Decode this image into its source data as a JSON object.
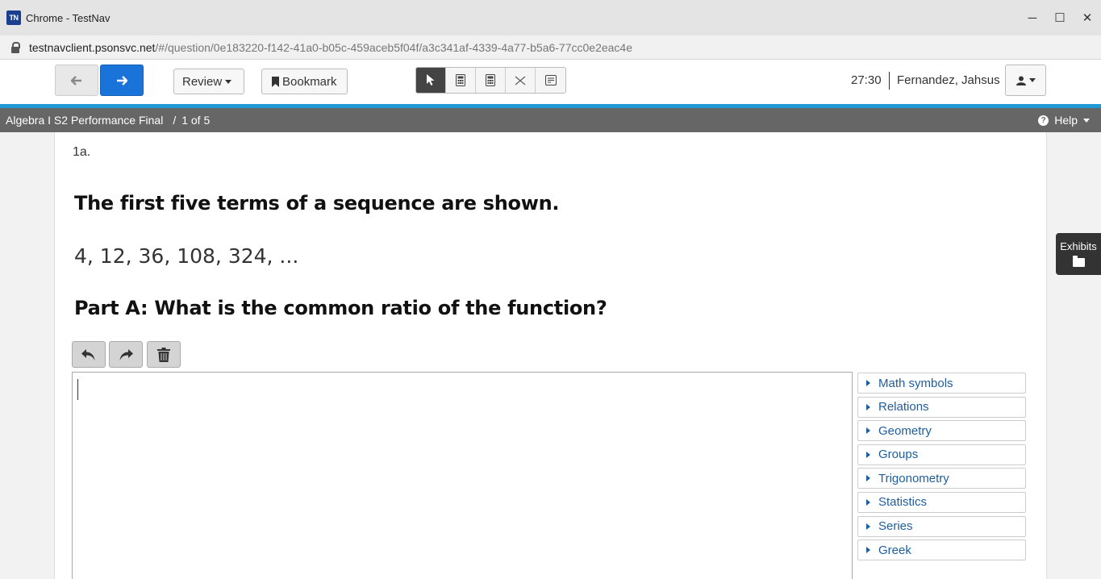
{
  "window": {
    "logo_text": "TN",
    "title": "Chrome - TestNav",
    "minimize": "─",
    "maximize": "☐",
    "close": "✕"
  },
  "address": {
    "host": "testnavclient.psonsvc.net",
    "path": "/#/question/0e183220-f142-41a0-b05c-459aceb5f04f/a3c341af-4339-4a77-b5a6-77cc0e2eac4e"
  },
  "toolbar": {
    "back_arrow": "🡐",
    "next_arrow": "🡒",
    "review_label": "Review",
    "bookmark_label": "Bookmark",
    "tools": [
      "pointer-tool",
      "calculator-tool",
      "scientific-calculator-tool",
      "answer-eliminator-tool",
      "notepad-tool"
    ],
    "timer": "27:30",
    "user_name": "Fernandez, Jahsus"
  },
  "test_bar": {
    "test_name": "Algebra I S2 Performance Final",
    "separator": "/",
    "position": "1 of 5",
    "help_label": "Help",
    "help_icon": "?"
  },
  "question": {
    "number": "1a.",
    "stem_line1": "The first five terms of a sequence are shown.",
    "sequence": "4, 12, 36, 108, 324, ...",
    "stem_line2": "Part A: What is the common ratio of the function?"
  },
  "editor": {
    "palette": [
      "Math symbols",
      "Relations",
      "Geometry",
      "Groups",
      "Trigonometry",
      "Statistics",
      "Series",
      "Greek"
    ]
  },
  "exhibits": {
    "label": "Exhibits"
  },
  "colors": {
    "accent_blue": "#1a73d9",
    "bar_blue": "#1e9ad6",
    "test_bar_gray": "#666666",
    "link_blue": "#1f5e9e"
  }
}
